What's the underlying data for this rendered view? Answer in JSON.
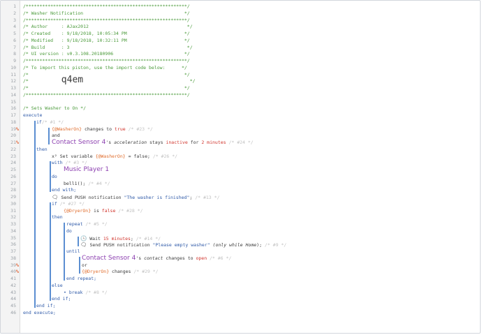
{
  "gutter": {
    "lines": [
      "1",
      "2",
      "3",
      "4",
      "5",
      "6",
      "7",
      "8",
      "9",
      "10",
      "11",
      "12",
      "13",
      "14",
      "15",
      "16",
      "17",
      "18",
      "19",
      "20",
      "21",
      "22",
      "23",
      "24",
      "25",
      "26",
      "27",
      "28",
      "29",
      "30",
      "31",
      "32",
      "33",
      "34",
      "35",
      "36",
      "37",
      "38",
      "39",
      "40",
      "41",
      "42",
      "43",
      "44",
      "45",
      "46"
    ],
    "flag_marker": "%",
    "flag_lines": [
      19,
      21,
      39,
      40
    ]
  },
  "code": {
    "header": {
      "border": "/***********************************************************/",
      "title": "/* Washer Notification                                     */",
      "author": "/* Author     : AJax2012                                    */",
      "created": "/* Created    : 9/18/2018, 10:05:34 PM                     */",
      "modified": "/* Modified   : 9/18/2018, 10:32:11 PM                     */",
      "build": "/* Build      : 3                                           */",
      "ui_version": "/* UI version : v0.3.108.20180906                          */",
      "import_text": "/* To import this piston, use the import code below:      */",
      "blank": "/*                                                         */",
      "import_prefix": "/*            ",
      "import_code": "q4em",
      "import_suffix": "                                       */"
    },
    "body": {
      "sets_comment": "/* Sets Washer to On */",
      "execute": "execute",
      "if1": "if",
      "if1_comment": "/* #1 */",
      "var_washer": "{@WasherOn}",
      "changes_to": " changes to ",
      "true_lit": "true",
      "c23": " /* #23 */",
      "and": "and",
      "contact_sensor": "Contact Sensor 4",
      "s_acceleration_pre": "'s ",
      "acceleration": "acceleration",
      "stays": " stays ",
      "inactive": "inactive",
      "for_text": " for ",
      "two_minutes": "2 minutes",
      "c24": " /* #24 */",
      "then": "then",
      "x2": "x²",
      "set_variable": " Set variable ",
      "equals_false": " = false;",
      "c26": " /* #26 */",
      "with": "with",
      "c3": " /* #3 */",
      "music_player": "Music Player 1",
      "do": "do",
      "bell": "bell1();",
      "c4": " /* #4 */",
      "end_with": "end with;",
      "send_push": " Send PUSH notification ",
      "washer_finished": "\"The washer is finished\"",
      "semicolon": ";",
      "c13": " /* #13 */",
      "if2": "if",
      "c27": " /* #27 */",
      "var_dryer": "{@DryerOn}",
      "is_text": " is ",
      "false_lit": "false",
      "c28": " /* #28 */",
      "repeat": "repeat",
      "c5": " /* #5 */",
      "wait": " Wait ",
      "fifteen": "15 minutes",
      "c14": " /* #14 */",
      "please_empty": "\"Please empty washer\"",
      "only_while": " (only while ",
      "home": "Home",
      "close_paren": ");",
      "c9": " /* #9 */",
      "until": "until",
      "contact": "contact",
      "changes_to2": " changes to ",
      "open": "open",
      "c6": " /* #6 */",
      "or": "or",
      "changes": " changes",
      "c29": " /* #29 */",
      "end_repeat": "end repeat;",
      "else": "else",
      "break": "break",
      "c8": " /* #8 */",
      "end_if_inner": "end if;",
      "end_if_outer": "end if;",
      "end_execute": "end execute;"
    }
  },
  "colors": {
    "comment_green": "#4a9a3a",
    "keyword_blue": "#2f5aa8",
    "variable_orange": "#e06b2a",
    "device_purple": "#8c3fb0",
    "literal_red": "#d0322a",
    "block_bar": "#5b8ed1"
  },
  "icons": [
    "expression-icon",
    "message-icon",
    "clock-icon"
  ]
}
